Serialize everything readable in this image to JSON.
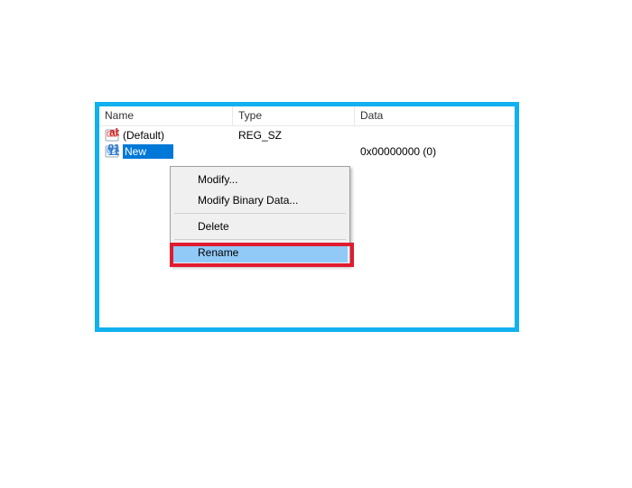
{
  "columns": {
    "name": "Name",
    "type": "Type",
    "data": "Data"
  },
  "rows": [
    {
      "name": "(Default)",
      "type": "REG_SZ",
      "data": ""
    },
    {
      "name": "New",
      "type": "",
      "data": "0x00000000 (0)"
    }
  ],
  "context_menu": {
    "modify": "Modify...",
    "modify_binary": "Modify Binary Data...",
    "delete": "Delete",
    "rename": "Rename"
  }
}
